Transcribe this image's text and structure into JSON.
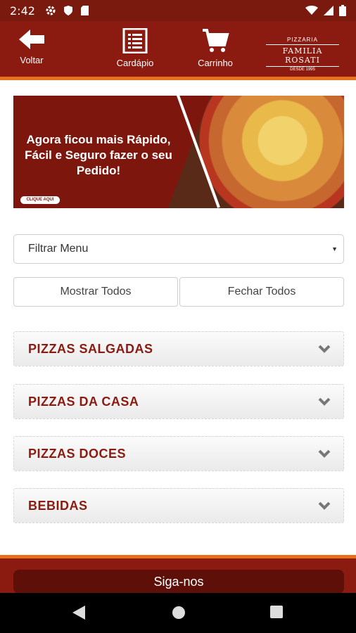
{
  "status_bar": {
    "time": "2:42"
  },
  "header": {
    "back_label": "Voltar",
    "menu_label": "Cardápio",
    "cart_label": "Carrinho",
    "logo": {
      "line1": "PIZZARIA",
      "line2": "FAMILIA ROSATI",
      "line3": "DESDE 1995"
    }
  },
  "banner": {
    "text": "Agora ficou mais Rápido, Fácil e Seguro fazer o seu Pedido!",
    "cta": "CLIQUE AQUI"
  },
  "filter": {
    "placeholder": "Filtrar Menu"
  },
  "buttons": {
    "show_all": "Mostrar Todos",
    "close_all": "Fechar Todos"
  },
  "categories": [
    {
      "name": "PIZZAS SALGADAS"
    },
    {
      "name": "PIZZAS DA CASA"
    },
    {
      "name": "PIZZAS DOCES"
    },
    {
      "name": "BEBIDAS"
    }
  ],
  "footer": {
    "follow_label": "Siga-nos"
  },
  "colors": {
    "primary": "#8b1b10",
    "accent": "#e8711c",
    "footer_button": "#5e0f07"
  },
  "icons": [
    "settings-icon",
    "shield-icon",
    "sd-card-icon",
    "wifi-icon",
    "signal-icon",
    "battery-icon",
    "arrow-left-icon",
    "menu-list-icon",
    "cart-icon",
    "chevron-down-icon",
    "nav-back-icon",
    "nav-home-icon",
    "nav-recents-icon"
  ]
}
